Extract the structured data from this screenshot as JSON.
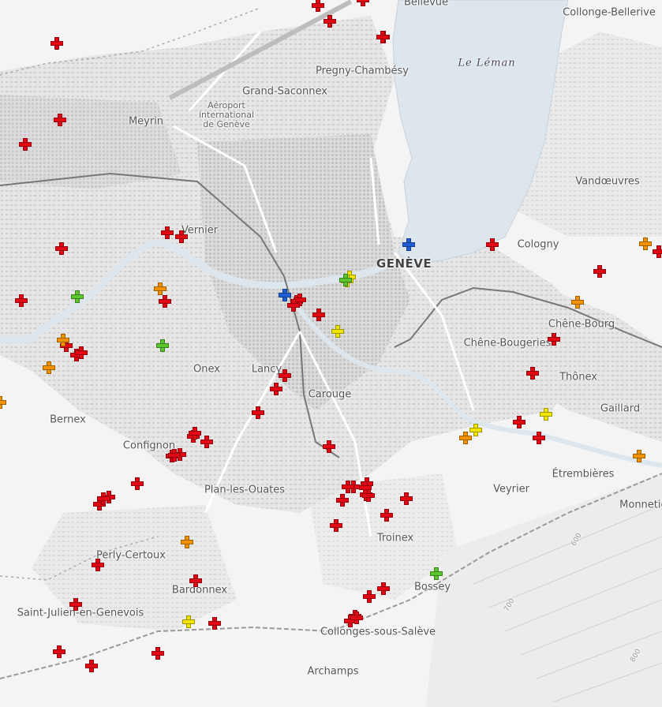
{
  "colors": {
    "red": "#e30613",
    "orange": "#f39200",
    "yellow": "#f2e500",
    "green": "#5ac52c",
    "blue": "#1f5fd6",
    "lake": "#dde6ec",
    "land": "#f4f4f4",
    "built": "#d9d9d9"
  },
  "map": {
    "lake_name": "Le Léman",
    "airport": [
      "Aéroport",
      "international",
      "de Genève"
    ],
    "main_city": "GENÈVE",
    "places": [
      "Bellevue",
      "Collonge-Bellerive",
      "Pregny-Chambésy",
      "Grand-Saconnex",
      "Meyrin",
      "Vandœuvres",
      "Vernier",
      "Cologny",
      "Chêne-Bourg",
      "Chêne-Bougeries",
      "Onex",
      "Lancy",
      "Carouge",
      "Thônex",
      "Bernex",
      "Gaillard",
      "Confignon",
      "Plan-les-Ouates",
      "Veyrier",
      "Étrembières",
      "Monnetier",
      "Troinex",
      "Perly-Certoux",
      "Bardonnex",
      "Bossey",
      "Saint-Julien-en-Genevois",
      "Collonges-sous-Salève",
      "Archamps"
    ],
    "contours": [
      "600",
      "700",
      "800"
    ]
  },
  "markers": {
    "red_count": 63,
    "orange_count": 9,
    "yellow_count": 6,
    "green_count": 4,
    "blue_count": 2
  }
}
